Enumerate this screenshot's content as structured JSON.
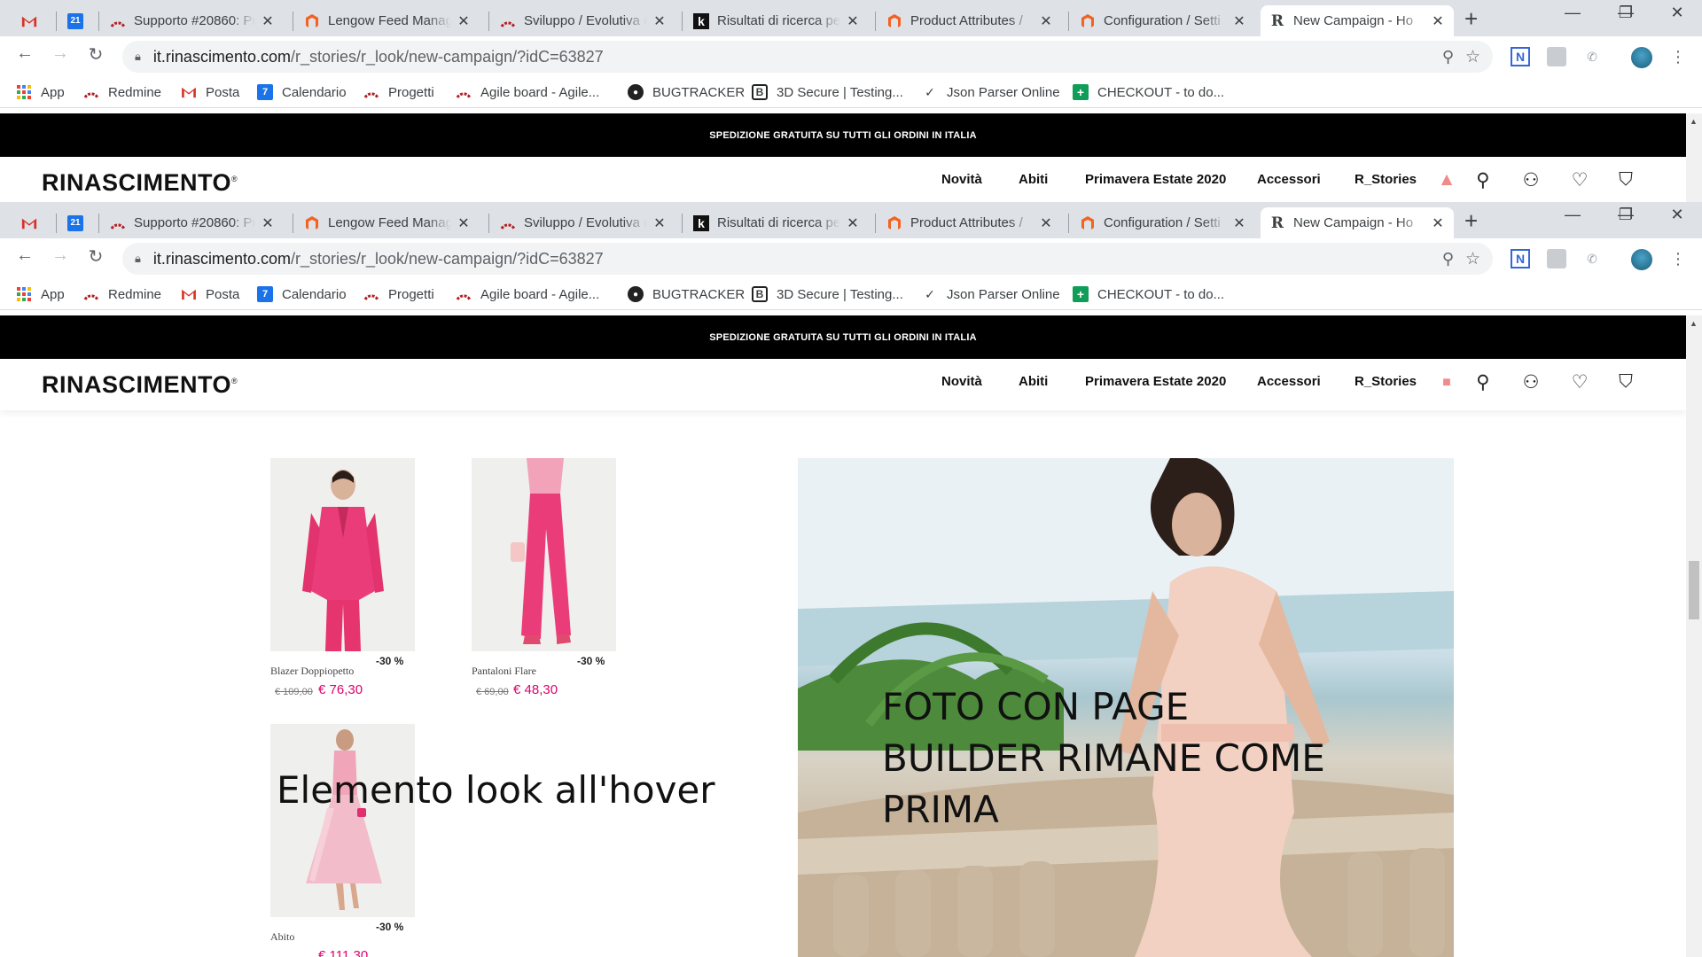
{
  "browser": {
    "tabs": [
      {
        "label": "",
        "icon": "gmail-icon"
      },
      {
        "label": "",
        "icon": "calendar-icon",
        "badge": "21"
      },
      {
        "label": "Supporto #20860: Pr",
        "icon": "redmine-icon"
      },
      {
        "label": "Lengow Feed Manag",
        "icon": "magento-icon"
      },
      {
        "label": "Sviluppo / Evolutiva #",
        "icon": "redmine-icon"
      },
      {
        "label": "Risultati di ricerca pe",
        "icon": "k-icon"
      },
      {
        "label": "Product Attributes / ",
        "icon": "magento-icon"
      },
      {
        "label": "Configuration / Setti",
        "icon": "magento-icon"
      },
      {
        "label": "New Campaign - Ho",
        "icon": "rinascimento-r-icon"
      }
    ],
    "url_host": "it.rinascimento.com",
    "url_path": "/r_stories/r_look/new-campaign/?idC=63827",
    "bookmarks": [
      {
        "label": "App",
        "icon": "apps-grid-icon"
      },
      {
        "label": "Redmine",
        "icon": "redmine-icon"
      },
      {
        "label": "Posta",
        "icon": "gmail-icon"
      },
      {
        "label": "Calendario",
        "icon": "calendar-icon"
      },
      {
        "label": "Progetti",
        "icon": "redmine-icon"
      },
      {
        "label": "Agile board - Agile...",
        "icon": "redmine-icon"
      },
      {
        "label": "BUGTRACKER",
        "icon": "github-icon"
      },
      {
        "label": "3D Secure | Testing...",
        "icon": "b-icon"
      },
      {
        "label": "Json Parser Online",
        "icon": "json-icon"
      },
      {
        "label": "CHECKOUT - to do...",
        "icon": "sheets-icon"
      }
    ],
    "calendar_day": "7"
  },
  "site": {
    "promo_bar": "SPEDIZIONE GRATUITA SU TUTTI GLI ORDINI IN ITALIA",
    "logo": "RINASCIMENTO",
    "menu": [
      "Novità",
      "Abiti",
      "Primavera Estate 2020",
      "Accessori",
      "R_Stories"
    ]
  },
  "products": [
    {
      "name": "Blazer Doppiopetto",
      "discount": "-30 %",
      "old_price": "€ 109,00",
      "new_price": "€ 76,30"
    },
    {
      "name": "Pantaloni Flare",
      "discount": "-30 %",
      "old_price": "€ 69,00",
      "new_price": "€ 48,30"
    },
    {
      "name": "Abito",
      "discount": "-30 %",
      "old_price": "",
      "new_price": "€ 111,30"
    }
  ],
  "annotations": {
    "look_hover": "Elemento look all'hover",
    "photo_note_line1": "FOTO CON PAGE",
    "photo_note_line2": "BUILDER RIMANE COME",
    "photo_note_line3": "PRIMA"
  },
  "colors": {
    "accent_price": "#e1006f",
    "promo_bar_bg": "#000000",
    "tabstrip_bg": "#dee1e6"
  }
}
